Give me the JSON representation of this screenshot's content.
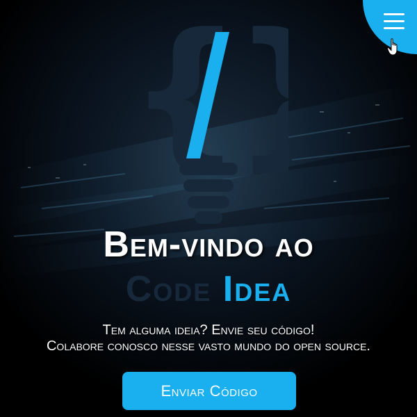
{
  "colors": {
    "accent": "#1ab0f0",
    "dark_text": "#16283a",
    "logo_dark": "#17283a",
    "background": "#000000",
    "light_text": "#ffffff"
  },
  "header": {
    "menu_icon": "hamburger-icon",
    "cursor_icon": "hand-pointer-icon"
  },
  "logo": {
    "icon": "code-lightbulb-logo"
  },
  "hero": {
    "title_line1": "Bem-vindo ao",
    "title_code": "Code",
    "title_idea": "Idea",
    "subtitle_line1": "Tem alguma ideia? Envie seu código!",
    "subtitle_line2": "Colabore conosco nesse vasto mundo do open source.",
    "cta_label": "Enviar Código"
  }
}
